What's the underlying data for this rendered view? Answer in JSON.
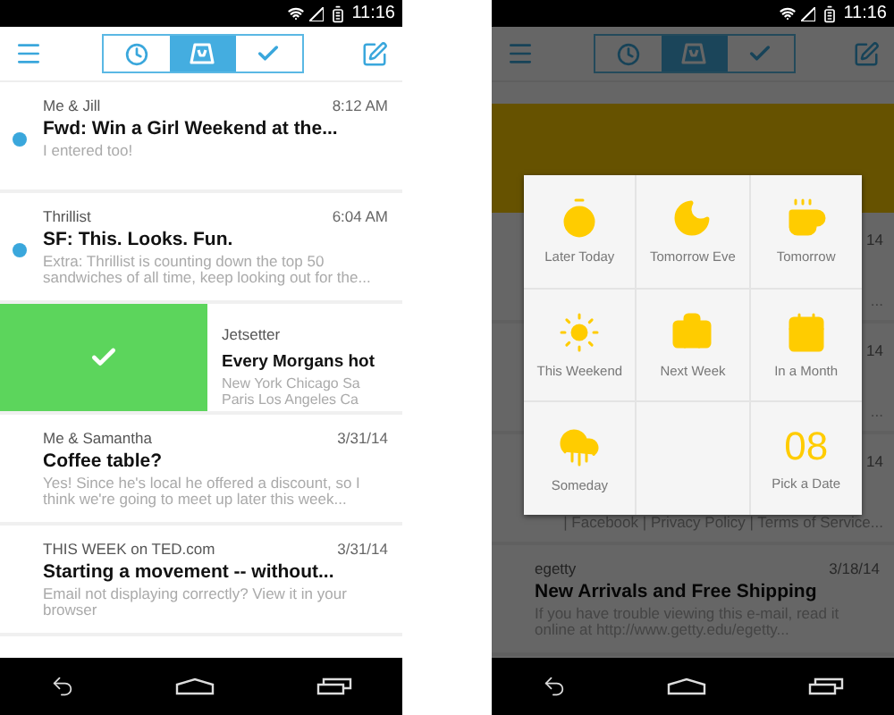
{
  "phones": [
    {
      "status_time": "11:16",
      "dimmed": false,
      "tabs": [
        {
          "kind": "later",
          "selected": false
        },
        {
          "kind": "inbox",
          "selected": true
        },
        {
          "kind": "done",
          "selected": false
        }
      ],
      "emails": [
        {
          "kind": "mail",
          "unread": true,
          "sender": "Me & Jill",
          "time": "8:12 AM",
          "subject": "Fwd: Win a Girl Weekend at the...",
          "preview": "I entered too!"
        },
        {
          "kind": "mail",
          "unread": true,
          "sender": "Thrillist",
          "time": "6:04 AM",
          "subject": "SF: This. Looks. Fun.",
          "preview": "Extra: Thrillist is counting down the top 50 sandwiches of all time, keep looking out for the..."
        },
        {
          "kind": "swiped",
          "sender": "Jetsetter",
          "subject": "Every Morgans hot",
          "preview": "New York Chicago Sa Paris Los Angeles Ca"
        },
        {
          "kind": "mail",
          "unread": false,
          "sender": "Me & Samantha",
          "time": "3/31/14",
          "subject": "Coffee table?",
          "preview": "Yes! Since he's local he offered a discount, so I think we're going to meet up later this week..."
        },
        {
          "kind": "mail",
          "unread": false,
          "sender": "THIS WEEK on TED.com",
          "time": "3/31/14",
          "subject": "Starting a movement -- without...",
          "preview": "Email not displaying correctly? View it in your browser"
        }
      ]
    },
    {
      "status_time": "11:16",
      "dimmed": true,
      "tabs": [
        {
          "kind": "later",
          "selected": false
        },
        {
          "kind": "inbox",
          "selected": true
        },
        {
          "kind": "done",
          "selected": false
        }
      ],
      "emails": [
        {
          "kind": "highlight"
        },
        {
          "kind": "fragment",
          "time": "14",
          "tail": "..."
        },
        {
          "kind": "fragment",
          "time": "14",
          "tail": "..."
        },
        {
          "kind": "fragment",
          "time": "14",
          "tail": "| Facebook | Privacy Policy | Terms of Service..."
        },
        {
          "kind": "mail",
          "unread": false,
          "sender": "egetty",
          "time": "3/18/14",
          "subject": "New Arrivals and Free Shipping",
          "preview": "If you have trouble viewing this e-mail, read it online at http://www.getty.edu/egetty..."
        }
      ],
      "snooze": [
        {
          "kind": "option",
          "label": "Later Today"
        },
        {
          "kind": "option",
          "label": "Tomorrow Eve"
        },
        {
          "kind": "option",
          "label": "Tomorrow"
        },
        {
          "kind": "option",
          "label": "This Weekend"
        },
        {
          "kind": "option",
          "label": "Next Week"
        },
        {
          "kind": "option",
          "label": "In a Month"
        },
        {
          "kind": "option",
          "label": "Someday"
        },
        {
          "kind": "empty"
        },
        {
          "kind": "date",
          "number": "08",
          "label": "Pick a Date"
        }
      ]
    }
  ]
}
